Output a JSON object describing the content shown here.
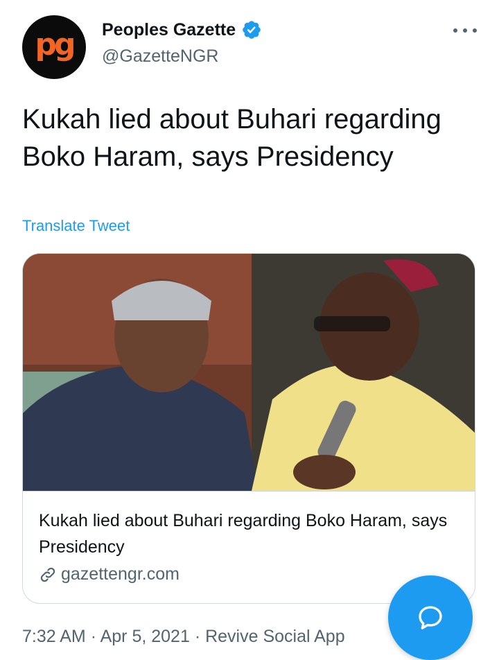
{
  "account": {
    "avatar_icon": "peoples-gazette-logo",
    "avatar_text": "pg",
    "display_name": "Peoples Gazette",
    "handle": "@GazetteNGR",
    "verified_icon": "verified-badge-icon"
  },
  "tweet": {
    "text": "Kukah lied about Buhari regarding Boko Haram, says Presidency",
    "translate_label": "Translate Tweet"
  },
  "card": {
    "title": "Kukah lied about Buhari regarding Boko Haram, says Presidency",
    "domain": "gazettengr.com"
  },
  "meta": {
    "time": "7:32 AM",
    "date": "Apr 5, 2021",
    "source": "Revive Social App",
    "separator": "·"
  },
  "colors": {
    "accent": "#1d9bf0",
    "secondary_text": "#536471",
    "brand_orange": "#f26522"
  }
}
